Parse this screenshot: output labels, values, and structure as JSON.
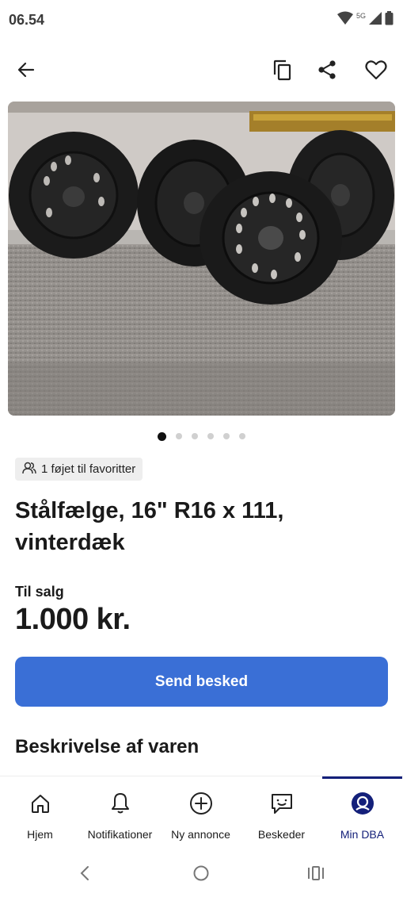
{
  "status": {
    "time": "06.54",
    "network": "5G"
  },
  "header": {
    "back_icon": "arrow-left-icon",
    "copy_icon": "copy-icon",
    "share_icon": "share-icon",
    "favorite_icon": "heart-icon"
  },
  "gallery": {
    "image_count": 6,
    "current_index": 1
  },
  "listing": {
    "favorites_text": "1 føjet til favoritter",
    "title": "Stålfælge, 16\" R16 x 111, vinterdæk",
    "sale_type": "Til salg",
    "price": "1.000 kr.",
    "send_button": "Send besked",
    "description_heading": "Beskrivelse af varen"
  },
  "bottom_nav": [
    {
      "label": "Hjem",
      "icon": "home-icon"
    },
    {
      "label": "Notifikationer",
      "icon": "bell-icon"
    },
    {
      "label": "Ny annonce",
      "icon": "plus-circle-icon"
    },
    {
      "label": "Beskeder",
      "icon": "chat-icon"
    },
    {
      "label": "Min DBA",
      "icon": "profile-icon"
    }
  ],
  "colors": {
    "accent": "#3a6fd6",
    "nav_active": "#14207a",
    "chip_bg": "#eeeeee"
  }
}
